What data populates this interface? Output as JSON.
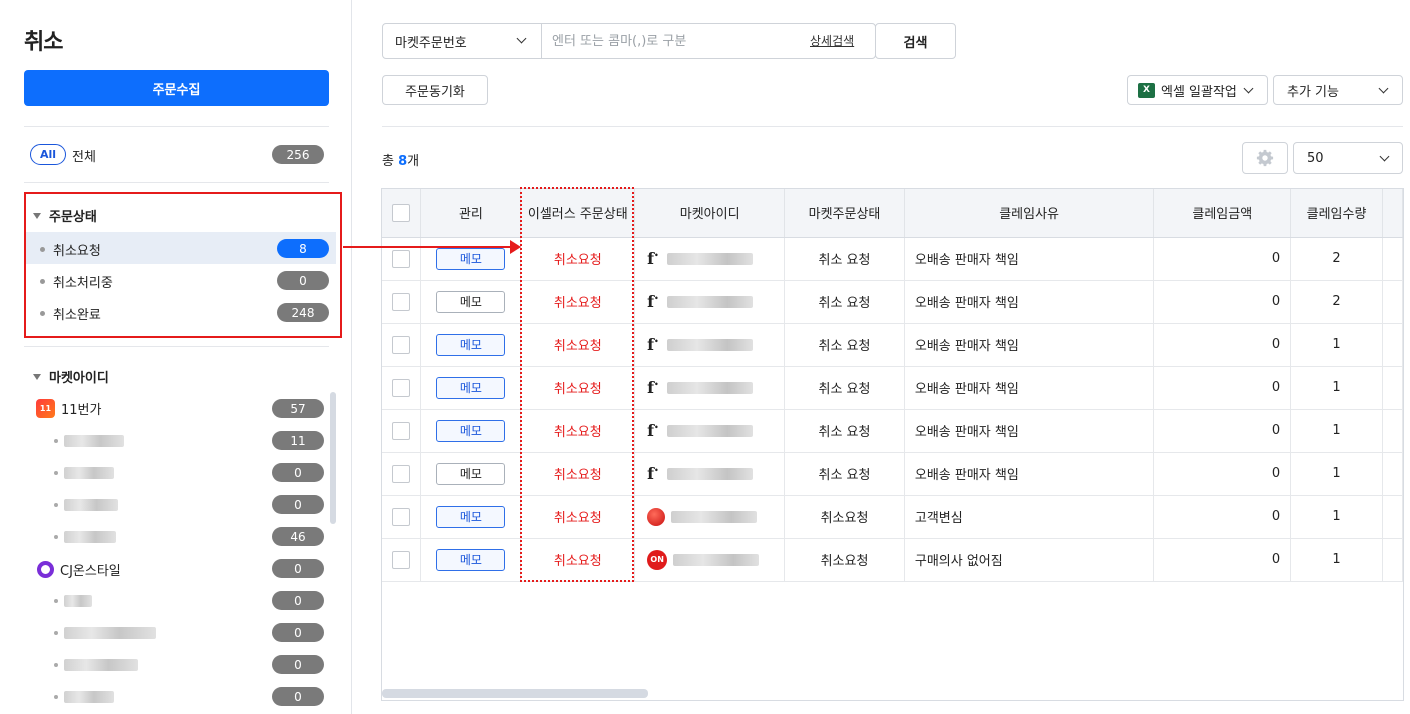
{
  "sidebar": {
    "title": "취소",
    "collect_button": "주문수집",
    "all": {
      "pill": "All",
      "label": "전체",
      "count": "256"
    },
    "order_status": {
      "title": "주문상태",
      "items": [
        {
          "label": "취소요청",
          "count": "8",
          "selected": true
        },
        {
          "label": "취소처리중",
          "count": "0"
        },
        {
          "label": "취소완료",
          "count": "248"
        }
      ]
    },
    "market_ids": {
      "title": "마켓아이디",
      "markets": [
        {
          "name": "11번가",
          "icon": "11st-logo-icon",
          "count": "57",
          "sub_counts": [
            "11",
            "0",
            "0",
            "46"
          ]
        },
        {
          "name": "CJ온스타일",
          "icon": "cj-onstyle-logo-icon",
          "count": "0",
          "sub_counts": [
            "0",
            "0",
            "0",
            "0"
          ]
        }
      ]
    }
  },
  "toolbar": {
    "search_type": "마켓주문번호",
    "search_placeholder": "엔터 또는 콤마(,)로 구분",
    "advanced_search": "상세검색",
    "search_button": "검색",
    "sync_button": "주문동기화",
    "excel_button": "엑셀 일괄작업",
    "excel_icon_text": "X",
    "more_button": "추가 기능",
    "page_size": "50"
  },
  "summary": {
    "prefix": "총 ",
    "count": "8",
    "suffix": "개"
  },
  "table": {
    "headers": [
      "관리",
      "이셀러스 주문상태",
      "마켓아이디",
      "마켓주문상태",
      "클레임사유",
      "클레임금액",
      "클레임수량"
    ],
    "rows": [
      {
        "memo": "메모",
        "memo_style": "blue",
        "status": "취소요청",
        "market_icon": "f",
        "market_status": "취소 요청",
        "reason": "오배송 판매자 책임",
        "amount": "0",
        "qty": "2"
      },
      {
        "memo": "메모",
        "memo_style": "gray",
        "status": "취소요청",
        "market_icon": "f",
        "market_status": "취소 요청",
        "reason": "오배송 판매자 책임",
        "amount": "0",
        "qty": "2"
      },
      {
        "memo": "메모",
        "memo_style": "blue",
        "status": "취소요청",
        "market_icon": "f",
        "market_status": "취소 요청",
        "reason": "오배송 판매자 책임",
        "amount": "0",
        "qty": "1"
      },
      {
        "memo": "메모",
        "memo_style": "blue",
        "status": "취소요청",
        "market_icon": "f",
        "market_status": "취소 요청",
        "reason": "오배송 판매자 책임",
        "amount": "0",
        "qty": "1"
      },
      {
        "memo": "메모",
        "memo_style": "blue",
        "status": "취소요청",
        "market_icon": "f",
        "market_status": "취소 요청",
        "reason": "오배송 판매자 책임",
        "amount": "0",
        "qty": "1"
      },
      {
        "memo": "메모",
        "memo_style": "gray",
        "status": "취소요청",
        "market_icon": "f",
        "market_status": "취소 요청",
        "reason": "오배송 판매자 책임",
        "amount": "0",
        "qty": "1"
      },
      {
        "memo": "메모",
        "memo_style": "blue",
        "status": "취소요청",
        "market_icon": "red-circle",
        "market_status": "취소요청",
        "reason": "고객변심",
        "amount": "0",
        "qty": "1"
      },
      {
        "memo": "메모",
        "memo_style": "blue",
        "status": "취소요청",
        "market_icon": "on",
        "market_status": "취소요청",
        "reason": "구매의사 없어짐",
        "amount": "0",
        "qty": "1"
      }
    ]
  },
  "colors": {
    "accent": "#0d6efd",
    "highlight_red": "#e51b1b",
    "count_gray": "#7a7a7a"
  }
}
